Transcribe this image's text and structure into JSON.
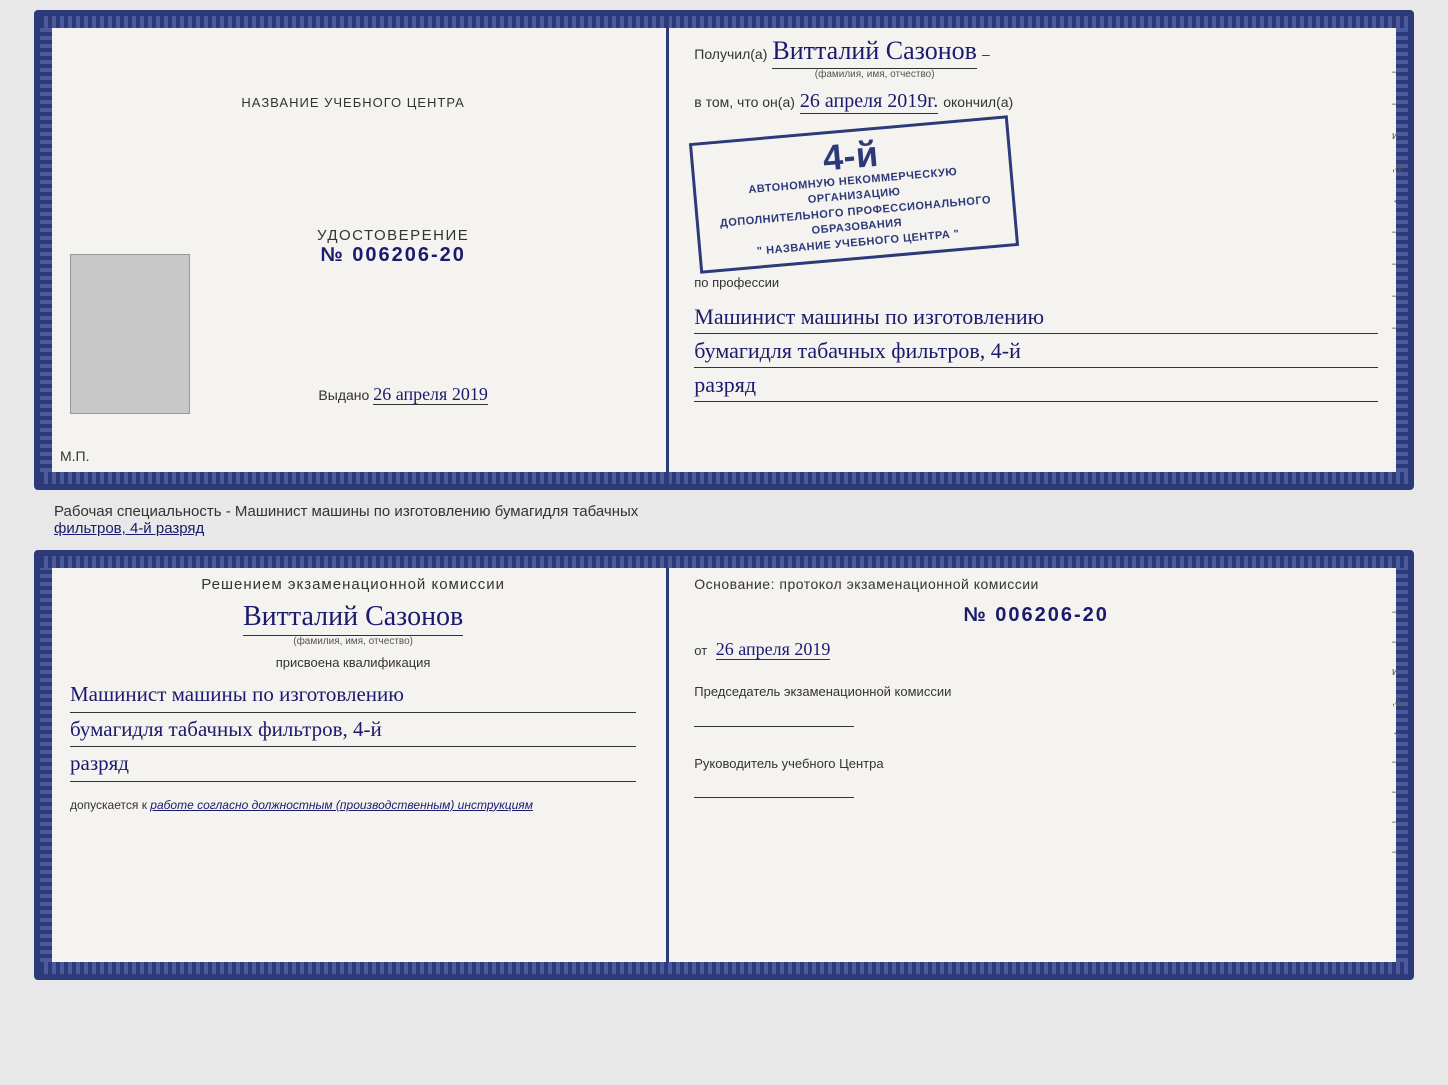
{
  "top_diploma": {
    "left": {
      "org_name_label": "НАЗВАНИЕ УЧЕБНОГО ЦЕНТРА",
      "udostoverenie_title": "УДОСТОВЕРЕНИЕ",
      "udostoverenie_number": "№ 006206-20",
      "vydano": "Выдано",
      "vydano_date": "26 апреля 2019",
      "mp": "М.П."
    },
    "right": {
      "poluchil_prefix": "Получил(а)",
      "recipient_name": "Витталий Сазонов",
      "fio_label": "(фамилия, имя, отчество)",
      "vtom_prefix": "в том, что он(а)",
      "vtom_date": "26 апреля 2019г.",
      "okonchil": "окончил(а)",
      "stamp_number": "4-й",
      "stamp_line1": "АВТОНОМНУЮ НЕКОММЕРЧЕСКУЮ ОРГАНИЗАЦИЮ",
      "stamp_line2": "ДОПОЛНИТЕЛЬНОГО ПРОФЕССИОНАЛЬНОГО ОБРАЗОВАНИЯ",
      "stamp_line3": "\" НАЗВАНИЕ УЧЕБНОГО ЦЕНТРА \"",
      "po_professii": "по профессии",
      "profession_line1": "Машинист машины по изготовлению",
      "profession_line2": "бумагидля табачных фильтров, 4-й",
      "profession_line3": "разряд"
    }
  },
  "specialty_text": {
    "line1": "Рабочая специальность - Машинист машины по изготовлению бумагидля табачных",
    "line2": "фильтров, 4-й разряд"
  },
  "bottom_diploma": {
    "left": {
      "komissia_title": "Решением экзаменационной комиссии",
      "recipient_name": "Витталий Сазонов",
      "fio_label": "(фамилия, имя, отчество)",
      "prisvoena": "присвоена квалификация",
      "profession_line1": "Машинист машины по изготовлению",
      "profession_line2": "бумагидля табачных фильтров, 4-й",
      "profession_line3": "разряд",
      "dopuskaetsya": "допускается к",
      "dopusk_value": "работе согласно должностным (производственным) инструкциям"
    },
    "right": {
      "osnovanie": "Основание: протокол экзаменационной комиссии",
      "protocol_number": "№ 006206-20",
      "ot_prefix": "от",
      "ot_date": "26 апреля 2019",
      "predsedatel_title": "Председатель экзаменационной комиссии",
      "rukovoditel_title": "Руководитель учебного Центра"
    }
  },
  "side_marks": {
    "marks": [
      "–",
      "–",
      "и",
      ",а",
      "←",
      "–",
      "–",
      "–",
      "–"
    ]
  }
}
